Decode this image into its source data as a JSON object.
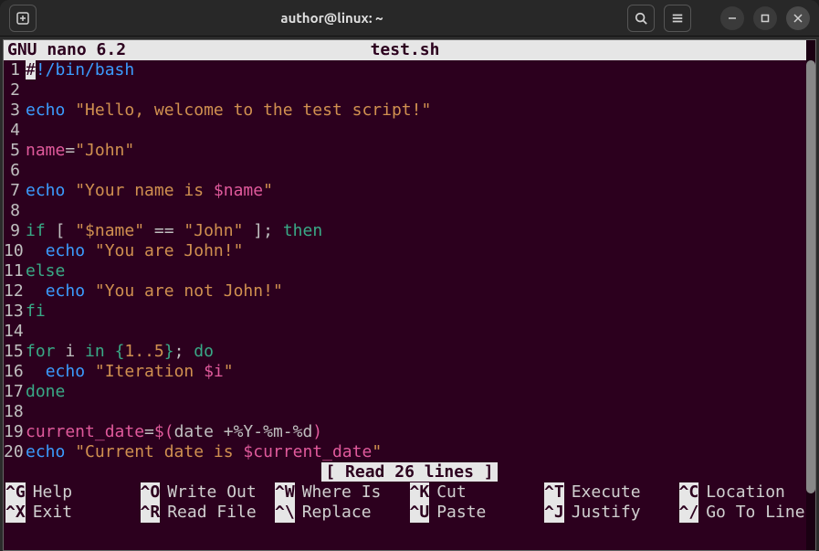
{
  "title": "author@linux: ~",
  "nano": {
    "app": "GNU nano 6.2",
    "filename": "test.sh",
    "status": "[ Read 26 lines ]"
  },
  "lines": [
    {
      "n": "1",
      "seg": [
        {
          "t": "#",
          "c": "cursor"
        },
        {
          "t": "!/bin/bash",
          "c": "c-comment"
        }
      ]
    },
    {
      "n": "2",
      "seg": []
    },
    {
      "n": "3",
      "seg": [
        {
          "t": "echo ",
          "c": "c-cmd"
        },
        {
          "t": "\"Hello, welcome to the test script!\"",
          "c": "c-string"
        }
      ]
    },
    {
      "n": "4",
      "seg": []
    },
    {
      "n": "5",
      "seg": [
        {
          "t": "name",
          "c": "c-var"
        },
        {
          "t": "=",
          "c": "c-op"
        },
        {
          "t": "\"John\"",
          "c": "c-assign"
        }
      ]
    },
    {
      "n": "6",
      "seg": []
    },
    {
      "n": "7",
      "seg": [
        {
          "t": "echo ",
          "c": "c-cmd"
        },
        {
          "t": "\"Your name is ",
          "c": "c-string"
        },
        {
          "t": "$name",
          "c": "c-var"
        },
        {
          "t": "\"",
          "c": "c-string"
        }
      ]
    },
    {
      "n": "8",
      "seg": []
    },
    {
      "n": "9",
      "seg": [
        {
          "t": "if ",
          "c": "c-keyword"
        },
        {
          "t": "[ ",
          "c": "c-text"
        },
        {
          "t": "\"$name\"",
          "c": "c-string"
        },
        {
          "t": " == ",
          "c": "c-text"
        },
        {
          "t": "\"John\"",
          "c": "c-string"
        },
        {
          "t": " ]",
          "c": "c-text"
        },
        {
          "t": "; ",
          "c": "c-op"
        },
        {
          "t": "then",
          "c": "c-keyword"
        }
      ]
    },
    {
      "n": "10",
      "seg": [
        {
          "t": "  ",
          "c": ""
        },
        {
          "t": "echo ",
          "c": "c-cmd"
        },
        {
          "t": "\"You are John!\"",
          "c": "c-string"
        }
      ]
    },
    {
      "n": "11",
      "seg": [
        {
          "t": "else",
          "c": "c-keyword"
        }
      ]
    },
    {
      "n": "12",
      "seg": [
        {
          "t": "  ",
          "c": ""
        },
        {
          "t": "echo ",
          "c": "c-cmd"
        },
        {
          "t": "\"You are not John!\"",
          "c": "c-string"
        }
      ]
    },
    {
      "n": "13",
      "seg": [
        {
          "t": "fi",
          "c": "c-keyword"
        }
      ]
    },
    {
      "n": "14",
      "seg": []
    },
    {
      "n": "15",
      "seg": [
        {
          "t": "for ",
          "c": "c-keyword"
        },
        {
          "t": "i ",
          "c": "c-text"
        },
        {
          "t": "in ",
          "c": "c-keyword"
        },
        {
          "t": "{",
          "c": "c-brace"
        },
        {
          "t": "1..5",
          "c": "c-num"
        },
        {
          "t": "}",
          "c": "c-brace"
        },
        {
          "t": "; ",
          "c": "c-op"
        },
        {
          "t": "do",
          "c": "c-keyword"
        }
      ]
    },
    {
      "n": "16",
      "seg": [
        {
          "t": "  ",
          "c": ""
        },
        {
          "t": "echo ",
          "c": "c-cmd"
        },
        {
          "t": "\"Iteration ",
          "c": "c-string"
        },
        {
          "t": "$i",
          "c": "c-var"
        },
        {
          "t": "\"",
          "c": "c-string"
        }
      ]
    },
    {
      "n": "17",
      "seg": [
        {
          "t": "done",
          "c": "c-keyword"
        }
      ]
    },
    {
      "n": "18",
      "seg": []
    },
    {
      "n": "19",
      "seg": [
        {
          "t": "current_date",
          "c": "c-var"
        },
        {
          "t": "=",
          "c": "c-op"
        },
        {
          "t": "$(",
          "c": "c-paren"
        },
        {
          "t": "date +%Y-%m-%d",
          "c": "c-text"
        },
        {
          "t": ")",
          "c": "c-paren"
        }
      ]
    },
    {
      "n": "20",
      "seg": [
        {
          "t": "echo ",
          "c": "c-cmd"
        },
        {
          "t": "\"Current date is ",
          "c": "c-string"
        },
        {
          "t": "$current_date",
          "c": "c-var"
        },
        {
          "t": "\"",
          "c": "c-string"
        }
      ]
    }
  ],
  "shortcuts": [
    {
      "key": "^G",
      "label": "Help"
    },
    {
      "key": "^O",
      "label": "Write Out"
    },
    {
      "key": "^W",
      "label": "Where Is"
    },
    {
      "key": "^K",
      "label": "Cut"
    },
    {
      "key": "^T",
      "label": "Execute"
    },
    {
      "key": "^C",
      "label": "Location"
    },
    {
      "key": "^X",
      "label": "Exit"
    },
    {
      "key": "^R",
      "label": "Read File"
    },
    {
      "key": "^\\",
      "label": "Replace"
    },
    {
      "key": "^U",
      "label": "Paste"
    },
    {
      "key": "^J",
      "label": "Justify"
    },
    {
      "key": "^/",
      "label": "Go To Line"
    }
  ]
}
